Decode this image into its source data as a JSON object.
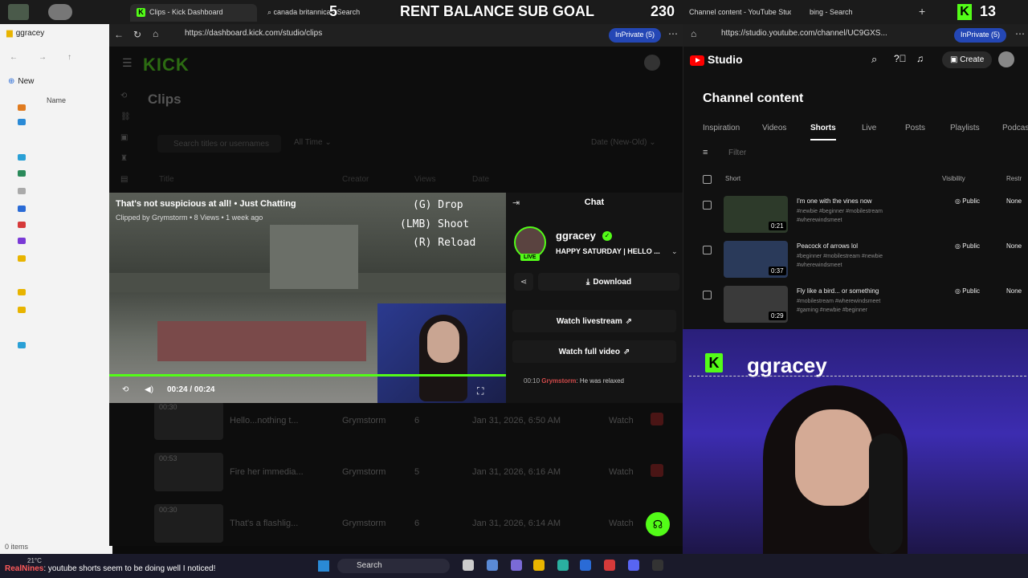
{
  "top_tabs": {
    "kick_tab": "Clips - Kick Dashboard",
    "search_tab": "canada britannica - Search",
    "yt_tab": "Channel content - YouTube Studio",
    "bing_tab": "bing - Search"
  },
  "goal_bar": {
    "left_count": "5",
    "label": "RENT BALANCE SUB GOAL",
    "right_count": "230",
    "far_right": "13"
  },
  "explorer": {
    "folder": "ggracey",
    "new_label": "New",
    "name_col": "Name",
    "items": "0 items"
  },
  "left_browser": {
    "url": "https://dashboard.kick.com/studio/clips",
    "inprivate": "InPrivate (5)"
  },
  "kick": {
    "logo": "KICK",
    "page_title": "Clips",
    "search_placeholder": "Search titles or usernames",
    "time_filter": "All Time",
    "sort_filter": "Date (New-Old)",
    "columns": [
      "Title",
      "Creator",
      "Views",
      "Date"
    ],
    "rows": [
      {
        "duration": "00:30",
        "title": "Hello...nothing t...",
        "creator": "Grymstorm",
        "views": "6",
        "date": "Jan 31, 2026, 6:50 AM",
        "action": "Watch"
      },
      {
        "duration": "00:53",
        "title": "Fire her immedia...",
        "creator": "Grymstorm",
        "views": "5",
        "date": "Jan 31, 2026, 6:16 AM",
        "action": "Watch"
      },
      {
        "duration": "00:30",
        "title": "That's a flashlig...",
        "creator": "Grymstorm",
        "views": "6",
        "date": "Jan 31, 2026, 6:14 AM",
        "action": "Watch"
      }
    ]
  },
  "player": {
    "title": "That's not suspicious at all! • Just Chatting",
    "meta": "Clipped by Grymstorm • 8 Views • 1 week ago",
    "hint_drop": "(G) Drop",
    "hint_shoot": "(LMB) Shoot",
    "hint_reload": "(R) Reload",
    "time": "00:24 / 00:24",
    "progress": 1.0
  },
  "chat": {
    "header": "Chat",
    "username": "ggracey",
    "live": "LIVE",
    "stream_title": "HAPPY SATURDAY | HELLO ...",
    "download": "Download",
    "watch_livestream": "Watch livestream",
    "watch_full": "Watch full video",
    "msg_time": "00:10",
    "msg_user": "Grymstorm",
    "msg_text": ": He was relaxed"
  },
  "youtube": {
    "url": "https://studio.youtube.com/channel/UC9GXS...",
    "inprivate": "InPrivate (5)",
    "brand": "Studio",
    "create": "Create",
    "heading": "Channel content",
    "tabs": [
      "Inspiration",
      "Videos",
      "Shorts",
      "Live",
      "Posts",
      "Playlists",
      "Podcasts"
    ],
    "filter": "Filter",
    "col_short": "Short",
    "col_visibility": "Visibility",
    "col_restrictions": "Restr",
    "shorts": [
      {
        "title": "I'm one with the vines now",
        "tags": "#newbie #beginner #mobilestream #wherewindsmeet",
        "duration": "0:21",
        "visibility": "Public",
        "restrictions": "None"
      },
      {
        "title": "Peacock of arrows lol",
        "tags": "#beginner #mobilestream #newbie #wherewindsmeet",
        "duration": "0:37",
        "visibility": "Public",
        "restrictions": "None"
      },
      {
        "title": "Fly like a bird... or something",
        "tags": "#mobilestream #wherewindsmeet #gaming #newbie #beginner",
        "duration": "0:29",
        "visibility": "Public",
        "restrictions": "None"
      }
    ]
  },
  "webcam": {
    "name": "ggracey"
  },
  "taskbar": {
    "weather": "21°C",
    "ticker_user": "RealNines",
    "ticker": ": youtube shorts seem to be doing well I noticed!",
    "search": "Search"
  },
  "colors": {
    "kick_green": "#53fc18",
    "yt_red": "#ff0000",
    "inprivate_blue": "#2447b5"
  }
}
